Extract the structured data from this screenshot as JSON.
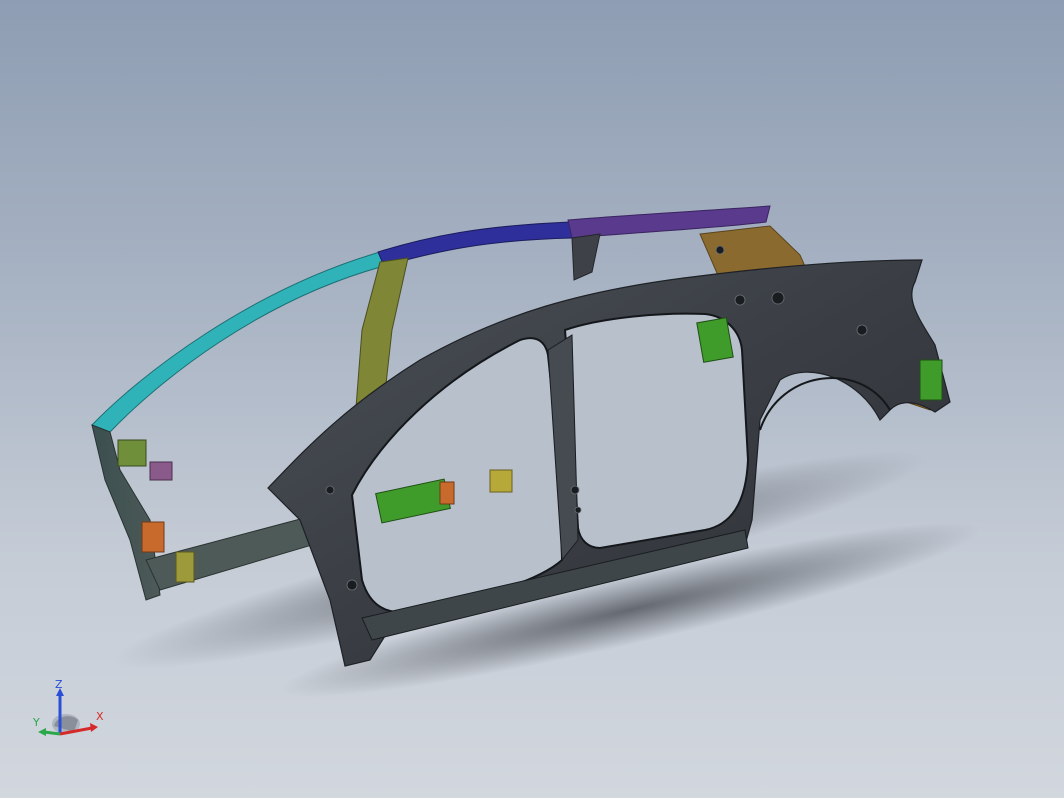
{
  "viewport": {
    "description_colors": {
      "background_top": "#8e9db3",
      "background_bottom": "#d2d7de",
      "body_dark": "#3d4147",
      "roof_rail_front": "#2fb3b8",
      "roof_rail_mid": "#2e2f9a",
      "roof_rail_rear": "#5a3a8c",
      "pillar_olive": "#7f8636",
      "bracket_green": "#3f9b2a",
      "bracket_orange": "#c96a2d",
      "rear_gold": "#8a6a2e"
    }
  },
  "triad": {
    "z_label": "Z",
    "x_label": "X",
    "y_label": "Y",
    "z_color": "#2a4fd6",
    "x_color": "#d62a2a",
    "y_color": "#2aa84a"
  }
}
